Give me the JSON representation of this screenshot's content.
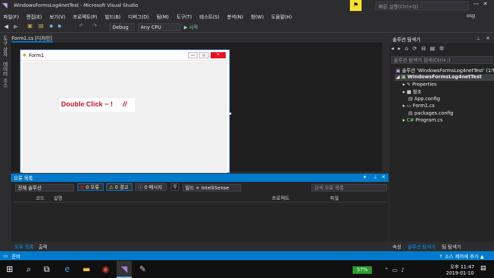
{
  "window": {
    "title": "WindowsFormsLog4netTest - Microsoft Visual Studio",
    "quick_launch": "빠른 실행(Ctrl+Q)",
    "user": "osg"
  },
  "menu": [
    "파일(F)",
    "편집(E)",
    "보기(V)",
    "프로젝트(P)",
    "빌드(B)",
    "디버그(D)",
    "팀(M)",
    "도구(T)",
    "테스트(S)",
    "분석(N)",
    "창(W)",
    "도움말(H)"
  ],
  "toolbar": {
    "config": "Debug",
    "platform": "Any CPU",
    "start": "▶ 시작"
  },
  "sidestrip": {
    "item1": "도구 상자",
    "item2": "데이터 소스"
  },
  "document": {
    "tab": "Form1.cs [디자인]",
    "form_title": "Form1",
    "label": "Double Click ~ !",
    "label_mark": "//"
  },
  "error_list": {
    "title": "오류 목록",
    "scope": "전체 솔루션",
    "errors": "0 오류",
    "warnings": "0 경고",
    "messages": "0 메시지",
    "build_filter": "빌드 + IntelliSense",
    "search": "검색 오류 목록",
    "columns": [
      "코드",
      "설명",
      "프로젝트",
      "파일"
    ],
    "bottom_tabs": [
      "오류 목록",
      "출력"
    ]
  },
  "solution": {
    "title": "솔루션 탐색기",
    "search": "솔루션 탐색기 검색(Ctrl+;)",
    "root": "솔루션 'WindowsFormsLog4netTest' (1개",
    "project": "WindowsFormsLog4netTest",
    "items": [
      "Properties",
      "참조",
      "App.config",
      "Form1.cs",
      "packages.config",
      "Program.cs"
    ],
    "bottom_tabs": [
      "속성",
      "솔루션 탐색기",
      "팀 탐색기"
    ]
  },
  "status": {
    "left": "준비",
    "right": "↑ 소스 제어에 추가 ▲"
  },
  "taskbar": {
    "battery": "57%",
    "time": "오후 11:47",
    "date": "2019-01-10"
  },
  "colors": {
    "accent": "#007acc",
    "label_red": "#c8102e"
  }
}
